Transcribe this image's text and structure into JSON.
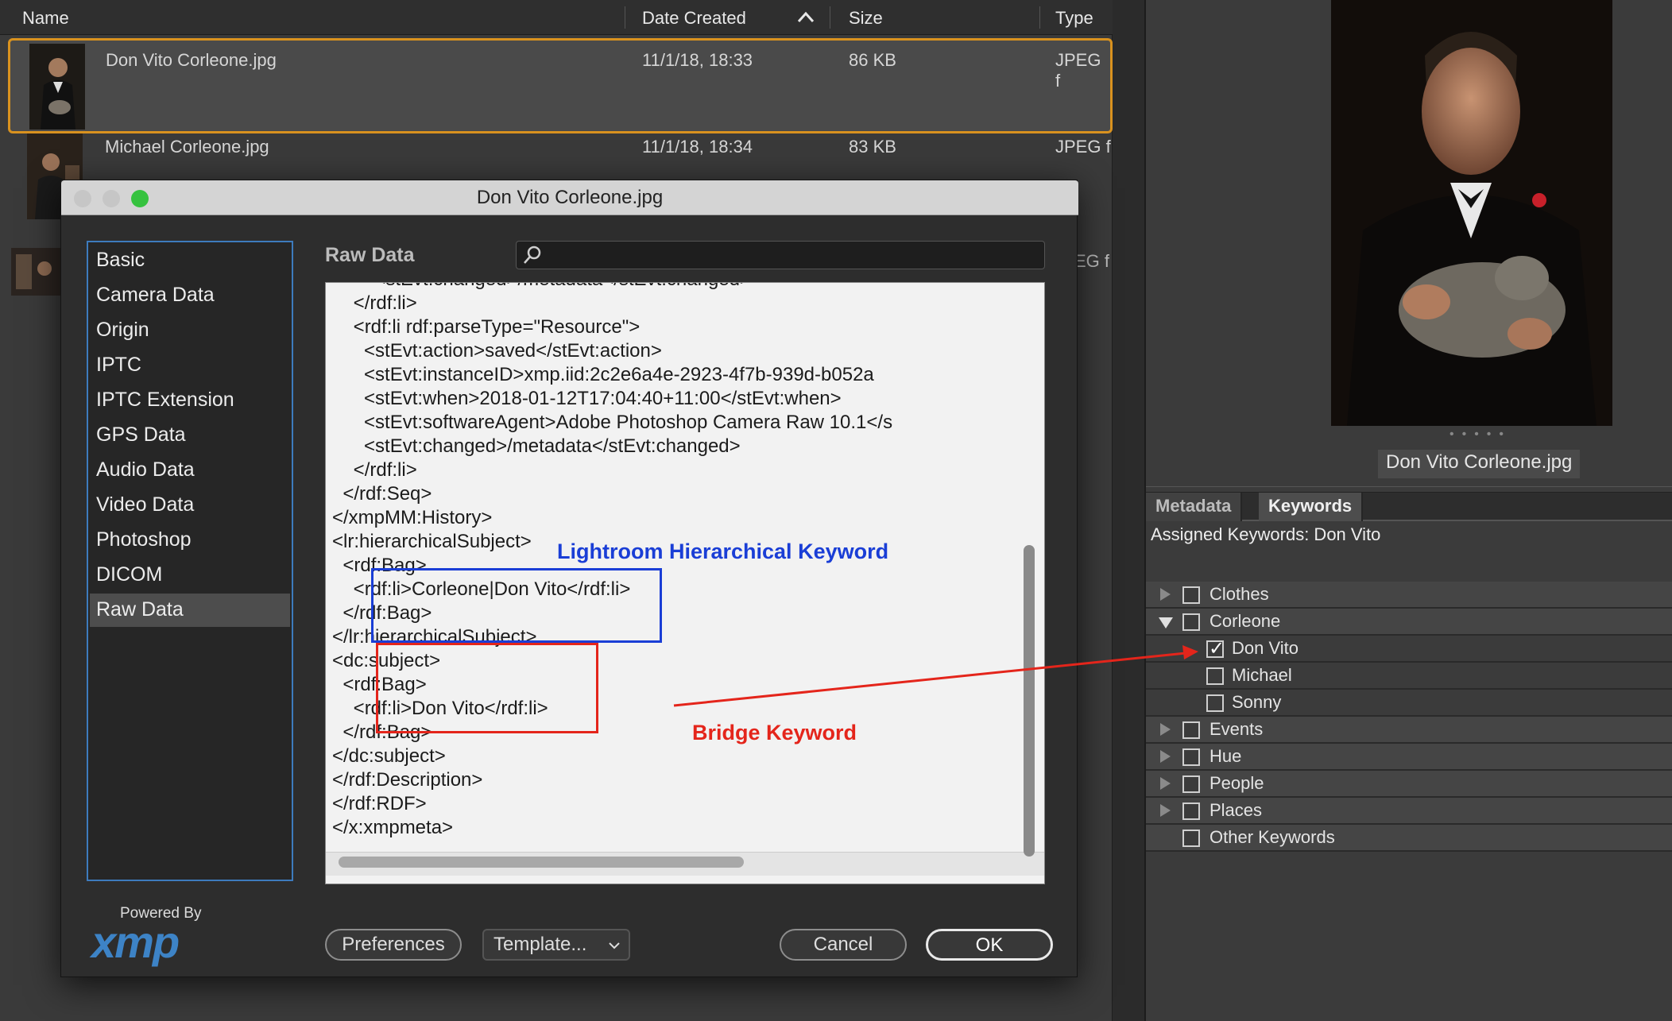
{
  "filelist": {
    "columns": {
      "name": "Name",
      "date": "Date Created",
      "size": "Size",
      "type": "Type"
    },
    "rows": [
      {
        "name": "Don Vito Corleone.jpg",
        "date": "11/1/18, 18:33",
        "size": "86 KB",
        "type": "JPEG f"
      },
      {
        "name": "Michael Corleone.jpg",
        "date": "11/1/18, 18:34",
        "size": "83 KB",
        "type": "JPEG f"
      }
    ],
    "partial_type": "EG f"
  },
  "dialog": {
    "title": "Don Vito Corleone.jpg",
    "sidebar": [
      "Basic",
      "Camera Data",
      "Origin",
      "IPTC",
      "IPTC Extension",
      "GPS Data",
      "Audio Data",
      "Video Data",
      "Photoshop",
      "DICOM",
      "Raw Data"
    ],
    "selected": "Raw Data",
    "section_label": "Raw Data",
    "xml_lines": [
      "        <stEvt:changed>/metadata</stEvt:changed>",
      "    </rdf:li>",
      "    <rdf:li rdf:parseType=\"Resource\">",
      "      <stEvt:action>saved</stEvt:action>",
      "      <stEvt:instanceID>xmp.iid:2c2e6a4e-2923-4f7b-939d-b052a",
      "      <stEvt:when>2018-01-12T17:04:40+11:00</stEvt:when>",
      "      <stEvt:softwareAgent>Adobe Photoshop Camera Raw 10.1</s",
      "      <stEvt:changed>/metadata</stEvt:changed>",
      "    </rdf:li>",
      "  </rdf:Seq>",
      "</xmpMM:History>",
      "<lr:hierarchicalSubject>",
      "  <rdf:Bag>",
      "    <rdf:li>Corleone|Don Vito</rdf:li>",
      "  </rdf:Bag>",
      "</lr:hierarchicalSubject>",
      "<dc:subject>",
      "  <rdf:Bag>",
      "    <rdf:li>Don Vito</rdf:li>",
      "  </rdf:Bag>",
      "</dc:subject>",
      "</rdf:Description>",
      "</rdf:RDF>",
      "</x:xmpmeta>"
    ],
    "annotations": {
      "lightroom": "Lightroom Hierarchical Keyword",
      "bridge": "Bridge Keyword",
      "lightroom_color": "#1a3ed6",
      "bridge_color": "#e4251b"
    },
    "powered_by": "Powered By",
    "xmp_logo": "xmp",
    "buttons": {
      "preferences": "Preferences",
      "template": "Template...",
      "cancel": "Cancel",
      "ok": "OK"
    }
  },
  "right_panel": {
    "preview_name": "Don Vito Corleone.jpg",
    "tabs": [
      "Metadata",
      "Keywords"
    ],
    "active_tab": "Keywords",
    "assigned": "Assigned Keywords: Don Vito",
    "keywords": [
      {
        "label": "Clothes",
        "level": 0,
        "expander": "collapsed",
        "checked": false
      },
      {
        "label": "Corleone",
        "level": 0,
        "expander": "expanded",
        "checked": false
      },
      {
        "label": "Don Vito",
        "level": 1,
        "expander": "none",
        "checked": true
      },
      {
        "label": "Michael",
        "level": 1,
        "expander": "none",
        "checked": false
      },
      {
        "label": "Sonny",
        "level": 1,
        "expander": "none",
        "checked": false
      },
      {
        "label": "Events",
        "level": 0,
        "expander": "collapsed",
        "checked": false
      },
      {
        "label": "Hue",
        "level": 0,
        "expander": "collapsed",
        "checked": false
      },
      {
        "label": "People",
        "level": 0,
        "expander": "collapsed",
        "checked": false
      },
      {
        "label": "Places",
        "level": 0,
        "expander": "collapsed",
        "checked": false
      },
      {
        "label": "Other Keywords",
        "level": 0,
        "expander": "none",
        "checked": false
      }
    ]
  }
}
